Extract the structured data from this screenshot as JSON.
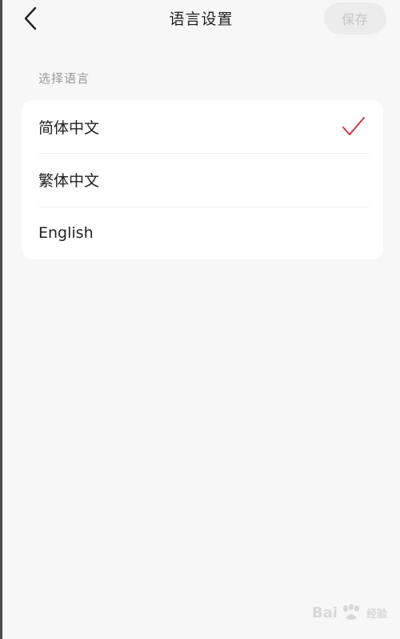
{
  "header": {
    "title": "语言设置",
    "save_label": "保存"
  },
  "section": {
    "label": "选择语言"
  },
  "languages": [
    {
      "label": "简体中文",
      "selected": true
    },
    {
      "label": "繁体中文",
      "selected": false
    },
    {
      "label": "English",
      "selected": false
    }
  ],
  "colors": {
    "accent": "#d9334b",
    "background": "#f7f7f7",
    "card": "#ffffff",
    "save_disabled_bg": "#ececec",
    "save_disabled_text": "#c4c4c4"
  },
  "watermark": {
    "brand": "Bai",
    "suffix": "经验"
  }
}
